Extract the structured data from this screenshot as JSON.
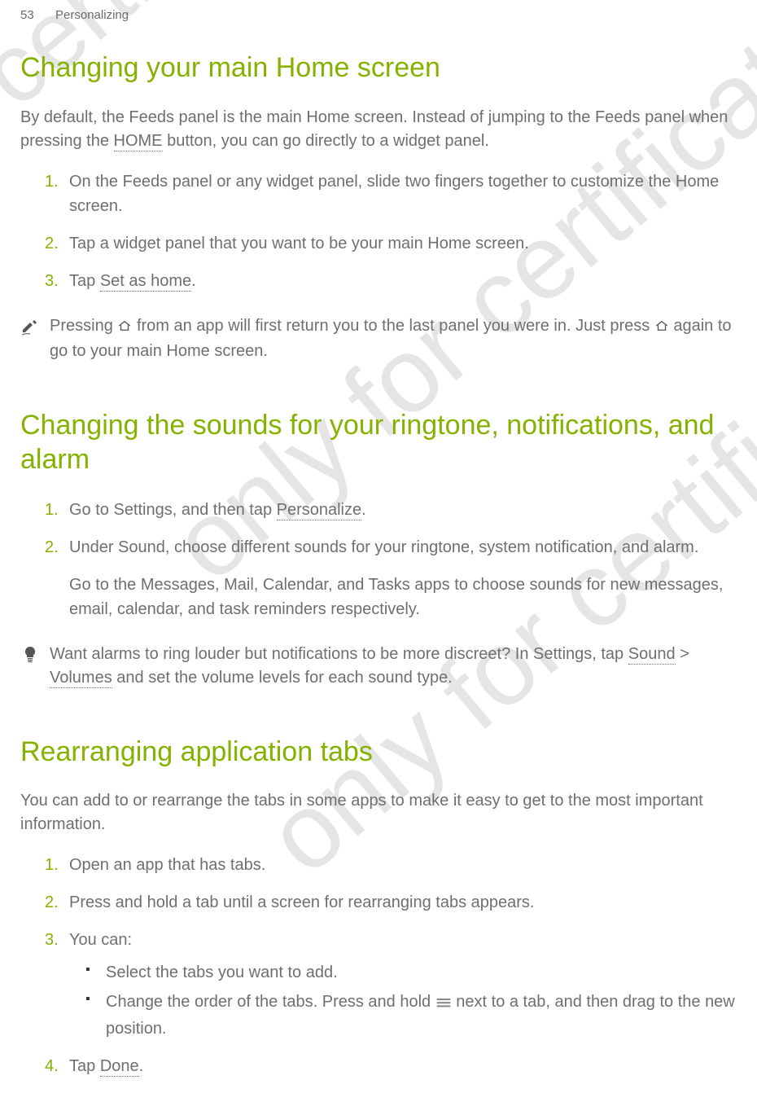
{
  "header": {
    "page_num": "53",
    "section": "Personalizing"
  },
  "watermarks": {
    "wm1": "for certific",
    "wm2": "only for certification",
    "wm3": "only for certific"
  },
  "section1": {
    "title": "Changing your main Home screen",
    "intro": "By default, the Feeds panel is the main Home screen. Instead of jumping to the Feeds panel when pressing the ",
    "intro_home": "HOME",
    "intro_end": " button, you can go directly to a widget panel.",
    "steps": [
      "On the Feeds panel or any widget panel, slide two fingers together to customize the Home screen.",
      "Tap a widget panel that you want to be your main Home screen.",
      "Tap "
    ],
    "step3_bold": "Set as home",
    "step3_end": ".",
    "note": {
      "pre": "Pressing ",
      "mid": " from an app will first return you to the last panel you were in. Just press ",
      "post": " again to go to your main Home screen."
    }
  },
  "section2": {
    "title": "Changing the sounds for your ringtone, notifications, and alarm",
    "steps": [
      {
        "pre": "Go to Settings, and then tap ",
        "bold": "Personalize",
        "post": "."
      },
      {
        "text": "Under Sound, choose different sounds for your ringtone, system notification, and alarm.",
        "para2": "Go to the Messages, Mail, Calendar, and Tasks apps to choose sounds for new messages, email, calendar, and task reminders respectively."
      }
    ],
    "tip": {
      "pre": "Want alarms to ring louder but notifications to be more discreet? In Settings, tap ",
      "bold1": "Sound",
      "gt": " > ",
      "bold2": "Volumes",
      "post": " and set the volume levels for each sound type."
    }
  },
  "section3": {
    "title": "Rearranging application tabs",
    "intro": "You can add to or rearrange the tabs in some apps to make it easy to get to the most important information.",
    "steps": [
      "Open an app that has tabs.",
      "Press and hold a tab until a screen for rearranging tabs appears.",
      "You can:"
    ],
    "bullets": [
      "Select the tabs you want to add.",
      {
        "pre": "Change the order of the tabs. Press and hold ",
        "post": " next to a tab, and then drag to the new position."
      }
    ],
    "step4_pre": "Tap ",
    "step4_bold": "Done",
    "step4_post": "."
  }
}
